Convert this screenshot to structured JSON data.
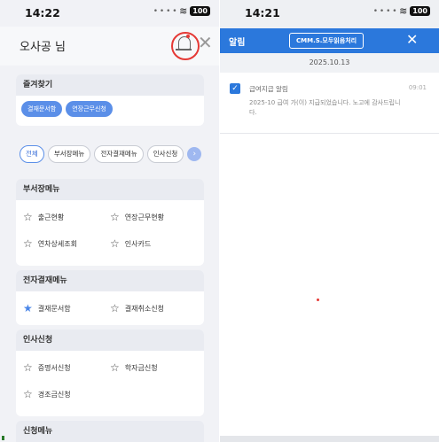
{
  "left": {
    "status": {
      "time": "14:22",
      "battery": "100"
    },
    "header": {
      "user_name": "오사공 님",
      "close_symbol": "✕"
    },
    "favorites": {
      "title": "즐겨찾기",
      "items": [
        "결재문서함",
        "연장근무신청"
      ]
    },
    "tabs": {
      "items": [
        "전체",
        "부서장메뉴",
        "전자결재메뉴",
        "인사신청"
      ],
      "arrow": "›",
      "active_index": 0
    },
    "sections": [
      {
        "title": "부서장메뉴",
        "items": [
          {
            "label": "출근현황",
            "filled": false
          },
          {
            "label": "연장근무현황",
            "filled": false
          },
          {
            "label": "연차상세조회",
            "filled": false
          },
          {
            "label": "인사카드",
            "filled": false
          }
        ]
      },
      {
        "title": "전자결재메뉴",
        "items": [
          {
            "label": "결재문서함",
            "filled": true
          },
          {
            "label": "결재취소신청",
            "filled": false
          }
        ]
      },
      {
        "title": "인사신청",
        "items": [
          {
            "label": "증명서신청",
            "filled": false
          },
          {
            "label": "학자금신청",
            "filled": false
          },
          {
            "label": "경조금신청",
            "filled": false
          }
        ]
      },
      {
        "title": "신청메뉴",
        "items": []
      }
    ]
  },
  "right": {
    "status": {
      "time": "14:21",
      "battery": "100"
    },
    "header": {
      "title": "알림",
      "badge": "CMM.S.모두읽음처리",
      "close_symbol": "✕"
    },
    "date": "2025.10.13",
    "notifications": [
      {
        "title": "급여지급 알림",
        "time": "09:01",
        "body": "2025-10 급여 가(이) 지급되었습니다. 노고에 감사드립니다.",
        "checked": true
      }
    ]
  },
  "colors": {
    "accent": "#2b78dc",
    "chip": "#5b8fe8",
    "bell_highlight": "#e53935"
  },
  "icons": {
    "bell": "bell-icon",
    "star": "star-icon",
    "check": "checkbox-icon"
  }
}
